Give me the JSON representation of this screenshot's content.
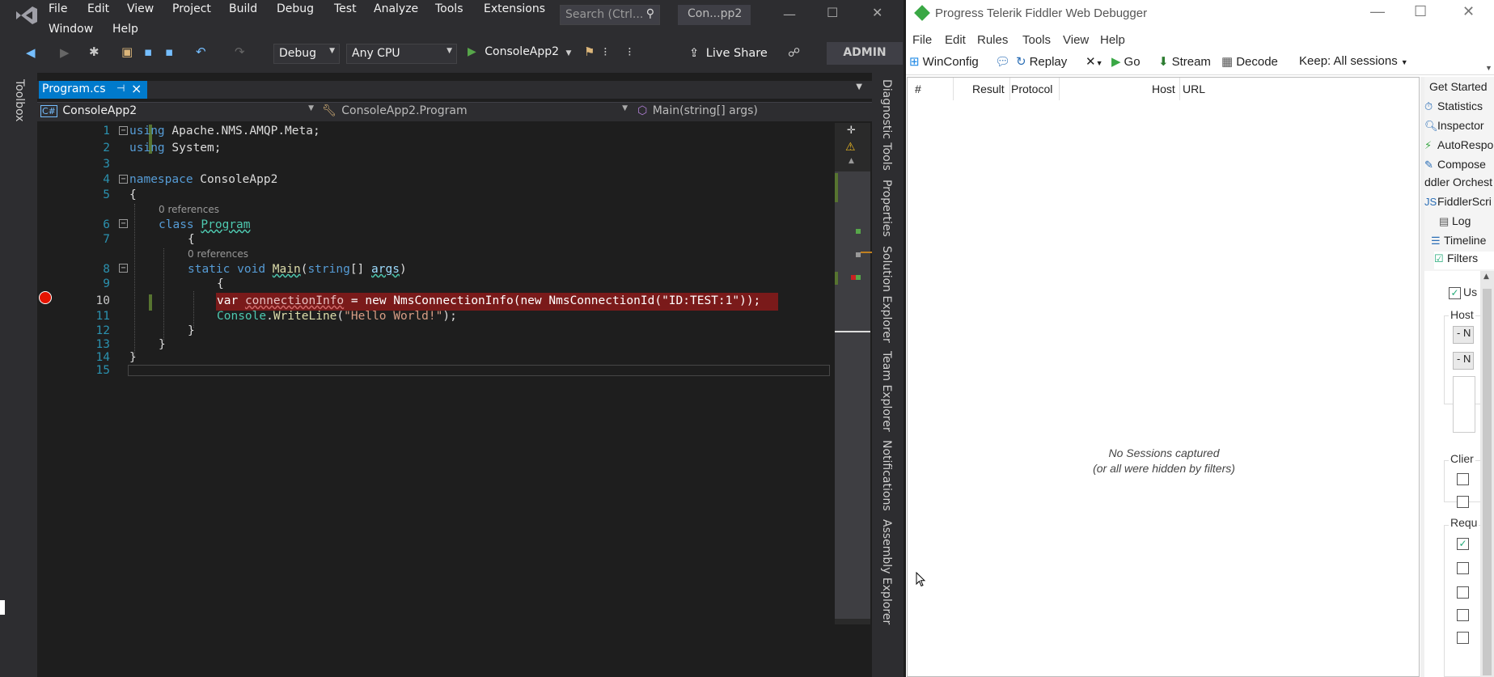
{
  "vs": {
    "menu": [
      "File",
      "Edit",
      "View",
      "Project",
      "Build",
      "Debug",
      "Test",
      "Analyze",
      "Tools",
      "Extensions"
    ],
    "menu_row2": [
      "Window",
      "Help"
    ],
    "search_placeholder": "Search (Ctrl...",
    "solution_name": "Con...pp2",
    "toolbar": {
      "config": "Debug",
      "platform": "Any CPU",
      "run_target": "ConsoleApp2",
      "live_share": "Live Share",
      "admin": "ADMIN"
    },
    "left_strip_label": "Toolbox",
    "right_strip_labels": [
      "Diagnostic Tools",
      "Properties",
      "Solution Explorer",
      "Team Explorer",
      "Notifications",
      "Assembly Explorer"
    ],
    "tab": {
      "name": "Program.cs",
      "pin": "⊣",
      "close": "×"
    },
    "nav": {
      "project": "ConsoleApp2",
      "class": "ConsoleApp2.Program",
      "member": "Main(string[] args)"
    },
    "code": {
      "line_numbers": [
        "1",
        "2",
        "3",
        "4",
        "5",
        "6",
        "7",
        "8",
        "9",
        "10",
        "11",
        "12",
        "13",
        "14",
        "15"
      ],
      "refs_label": "0 references",
      "l1": [
        "using",
        " Apache.NMS.AMQP.Meta;"
      ],
      "l2": [
        "using",
        " System;"
      ],
      "l4": [
        "namespace",
        " ConsoleApp2"
      ],
      "l5": "{",
      "l6": [
        "class",
        " ",
        "Program"
      ],
      "l7": "{",
      "l8": [
        "static",
        " ",
        "void",
        " ",
        "Main",
        "(",
        "string",
        "[] ",
        "args",
        ")"
      ],
      "l9": "{",
      "l10": [
        "var",
        " ",
        "connectionInfo",
        " = ",
        "new",
        " ",
        "NmsConnectionInfo",
        "(",
        "new",
        " ",
        "NmsConnectionId",
        "(",
        "\"ID:TEST:1\"",
        "));"
      ],
      "l11": [
        "Console",
        ".",
        "WriteLine",
        "(",
        "\"Hello World!\"",
        ");"
      ],
      "l12": "}",
      "l13": "}",
      "l14": "}"
    }
  },
  "fiddler": {
    "title": "Progress Telerik Fiddler Web Debugger",
    "menu": [
      "File",
      "Edit",
      "Rules",
      "Tools",
      "View",
      "Help"
    ],
    "toolbar": {
      "winconfig": "WinConfig",
      "replay": "Replay",
      "go": "Go",
      "stream": "Stream",
      "decode": "Decode",
      "keep": "Keep: All sessions"
    },
    "columns": [
      "#",
      "Result",
      "Protocol",
      "Host",
      "URL"
    ],
    "empty_line1": "No Sessions captured",
    "empty_line2": "(or all were hidden by filters)",
    "side_tabs": [
      "Get Started",
      "Statistics",
      "Inspector",
      "AutoRespor",
      "Compose",
      "ddler Orchest",
      "FiddlerScri",
      "Log",
      "Timeline",
      "Filters"
    ],
    "filters": {
      "use_label": "Us",
      "hosts_label": "Host",
      "btn1": "- N",
      "btn2": "- N",
      "client_label": "Clier",
      "request_label": "Requ"
    }
  }
}
